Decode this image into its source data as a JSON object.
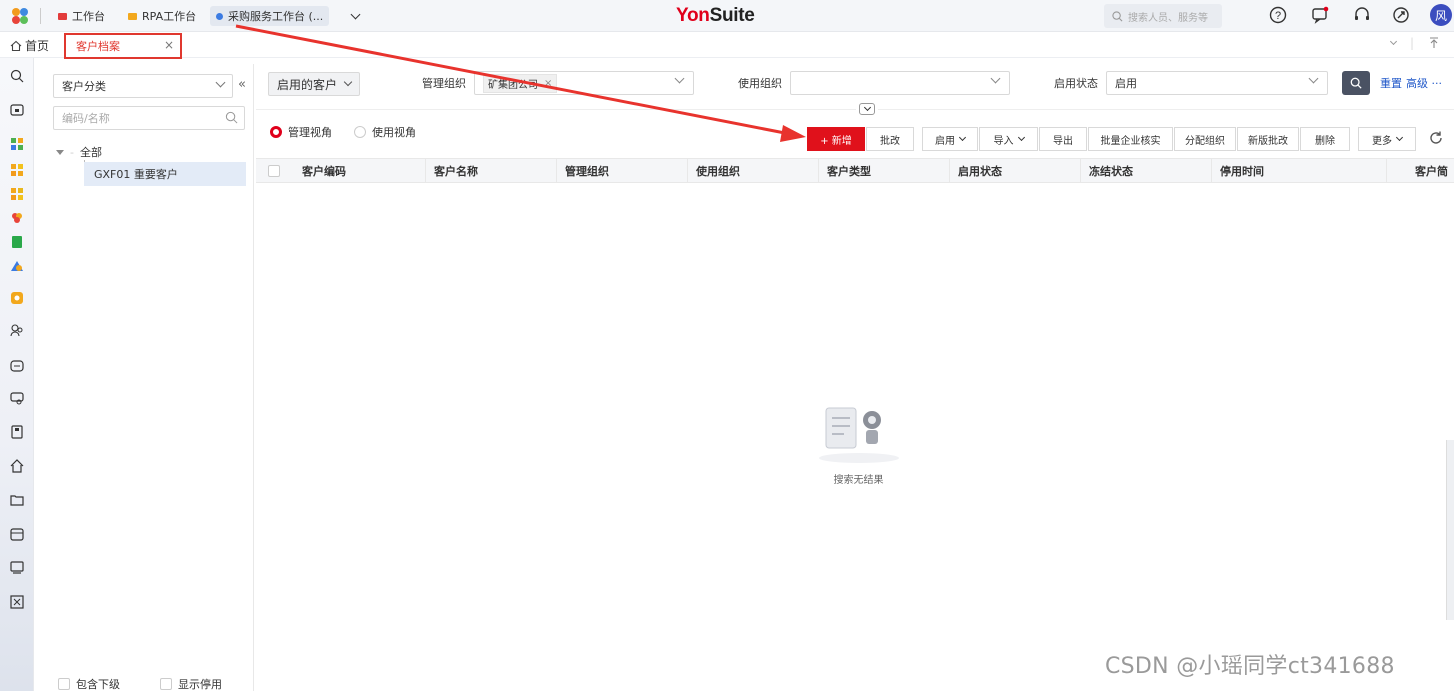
{
  "topbar": {
    "tabs": [
      {
        "label": "工作台",
        "color": "#e23b3b"
      },
      {
        "label": "RPA工作台",
        "color": "#f2a81d"
      },
      {
        "label": "采购服务工作台 (...",
        "color": "#3b7be2"
      }
    ],
    "brand_you": "Yon",
    "brand_suite": "Suite",
    "search_placeholder": "搜索人员、服务等",
    "avatar_text": "风"
  },
  "tabbar": {
    "home_label": "首页",
    "active_tab_label": "客户档案",
    "close_symbol": "×"
  },
  "category": {
    "select_value": "客户分类",
    "search_placeholder": "编码/名称",
    "root_label": "全部",
    "items": [
      {
        "label": "GXF01 重要客户"
      }
    ],
    "include_sub_label": "包含下级",
    "show_disabled_label": "显示停用"
  },
  "filters": {
    "scope_button": "启用的客户",
    "mgmt_org_label": "管理组织",
    "mgmt_org_tag": "矿集团公司",
    "use_org_label": "使用组织",
    "status_label": "启用状态",
    "status_value": "启用",
    "reset_label": "重置",
    "advanced_label": "高级 ···"
  },
  "view": {
    "mgmt_view": "管理视角",
    "use_view": "使用视角"
  },
  "toolbar": {
    "add_label": "+ 新增",
    "batch_edit": "批改",
    "enable": "启用",
    "import": "导入",
    "export": "导出",
    "batch_verify": "批量企业核实",
    "assign_org": "分配组织",
    "new_batch_edit": "新版批改",
    "delete": "删除",
    "more": "更多"
  },
  "table": {
    "columns": [
      "客户编码",
      "客户名称",
      "管理组织",
      "使用组织",
      "客户类型",
      "启用状态",
      "冻结状态",
      "停用时间",
      "客户简"
    ],
    "rows": []
  },
  "empty_text": "搜索无结果",
  "watermark": "CSDN @小瑶同学ct341688",
  "colors": {
    "accent": "#e0111b",
    "annotation": "#e8332d",
    "link": "#1f57c9"
  }
}
